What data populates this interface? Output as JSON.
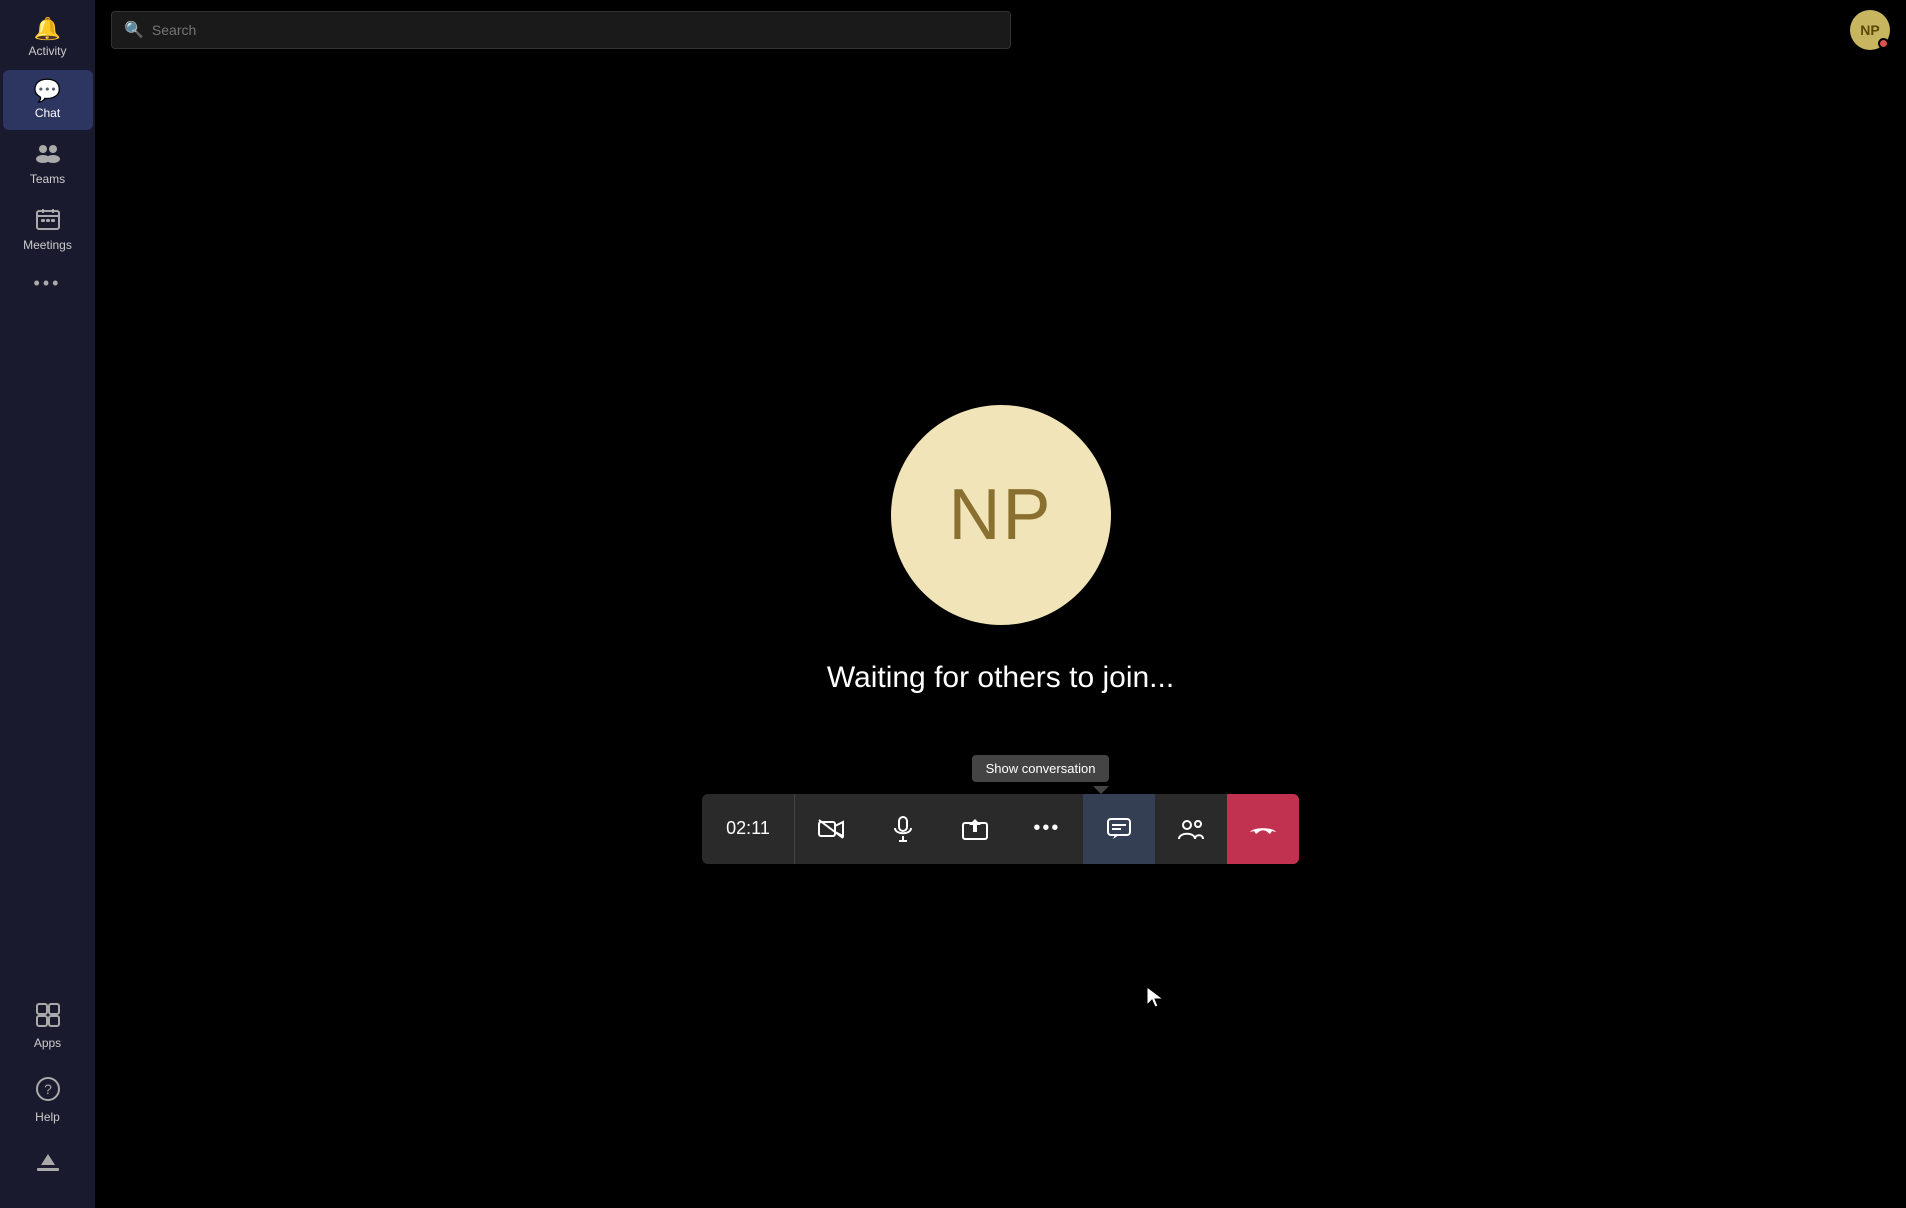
{
  "sidebar": {
    "items": [
      {
        "id": "activity",
        "label": "Activity",
        "icon": "🔔",
        "active": false
      },
      {
        "id": "chat",
        "label": "Chat",
        "icon": "💬",
        "active": true
      },
      {
        "id": "teams",
        "label": "Teams",
        "icon": "👥",
        "active": false
      },
      {
        "id": "meetings",
        "label": "Meetings",
        "icon": "📅",
        "active": false
      },
      {
        "id": "more",
        "label": "•••",
        "icon": "···",
        "active": false
      }
    ],
    "bottom_items": [
      {
        "id": "apps",
        "label": "Apps",
        "icon": "⊞",
        "active": false
      },
      {
        "id": "help",
        "label": "Help",
        "icon": "?",
        "active": false
      },
      {
        "id": "update",
        "label": "",
        "icon": "⬇",
        "active": false
      }
    ]
  },
  "topbar": {
    "search_placeholder": "Search",
    "user_initials": "NP"
  },
  "call": {
    "avatar_initials": "NP",
    "waiting_text": "Waiting for others to join...",
    "timer": "02:11",
    "tooltip": "Show conversation"
  },
  "controls": {
    "video_label": "video",
    "mic_label": "microphone",
    "share_label": "share screen",
    "more_label": "more options",
    "conversation_label": "show conversation",
    "participants_label": "participants",
    "end_call_label": "end call"
  }
}
